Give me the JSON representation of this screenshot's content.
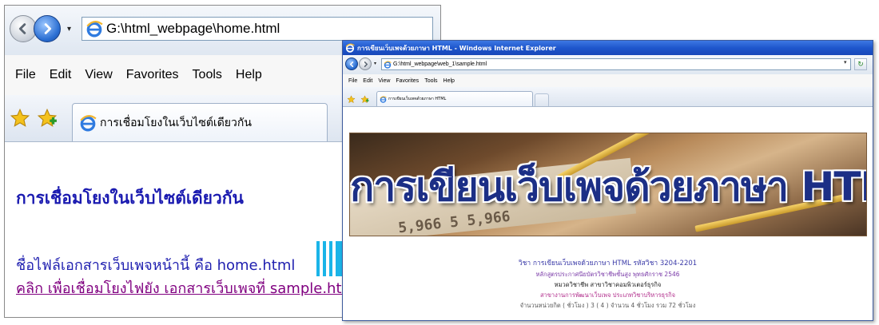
{
  "left_browser": {
    "address": "G:\\html_webpage\\home.html",
    "dropdown_glyph": "▾",
    "menu": [
      "File",
      "Edit",
      "View",
      "Favorites",
      "Tools",
      "Help"
    ],
    "tab_title": "การเชื่อมโยงในเว็บไซต์เดียวกัน",
    "heading": "การเชื่อมโยงในเว็บไซต์เดียวกัน",
    "line1": "ชื่อไฟล์เอกสารเว็บเพจหน้านี้ คือ home.html",
    "link_text": "คลิก เพื่อเชื่อมโยงไฟยัง เอกสารเว็บเพจที่ sample.html"
  },
  "right_browser": {
    "window_title": "การเขียนเว็บเพจด้วยภาษา HTML - Windows Internet Explorer",
    "address": "G:\\html_webpage\\web_1\\sample.html",
    "dropdown_glyph": "▾",
    "go_glyph": "▾",
    "refresh_glyph": "↻",
    "menu": [
      "File",
      "Edit",
      "View",
      "Favorites",
      "Tools",
      "Help"
    ],
    "tab_title": "การเขียนเว็บเพจด้วยภาษา HTML",
    "banner_title": "การเขียนเว็บเพจด้วยภาษา HTML",
    "banner_digits": "5,966  5  5,966",
    "info": [
      "วิชา การเขียนเว็บเพจด้วยภาษา HTML รหัสวิชา 3204-2201",
      "หลักสูตรประกาศนียบัตรวิชาชีพชั้นสูง พุทธศักราช 2546",
      "หมวดวิชาชีพ สาขาวิชาคอมพิวเตอร์ธุรกิจ",
      "สาขางานการพัฒนาเว็บเพจ ประเภทวิชาบริหารธุรกิจ",
      "จำนวนหน่วยกิต ( ชั่วโมง ) 3 ( 4 ) จำนวน 4 ชั่วโมง รวม 72 ชั่วโมง"
    ]
  },
  "icons": [
    "back-arrow-icon",
    "forward-arrow-icon",
    "ie-page-icon",
    "favorites-star-icon",
    "add-favorites-icon",
    "transition-arrow-icon"
  ],
  "colors": {
    "heading_blue": "#1a1ab0",
    "visited_link": "#800080",
    "arrow_cyan": "#1ab4e8",
    "titlebar_blue": "#1e56cc"
  }
}
